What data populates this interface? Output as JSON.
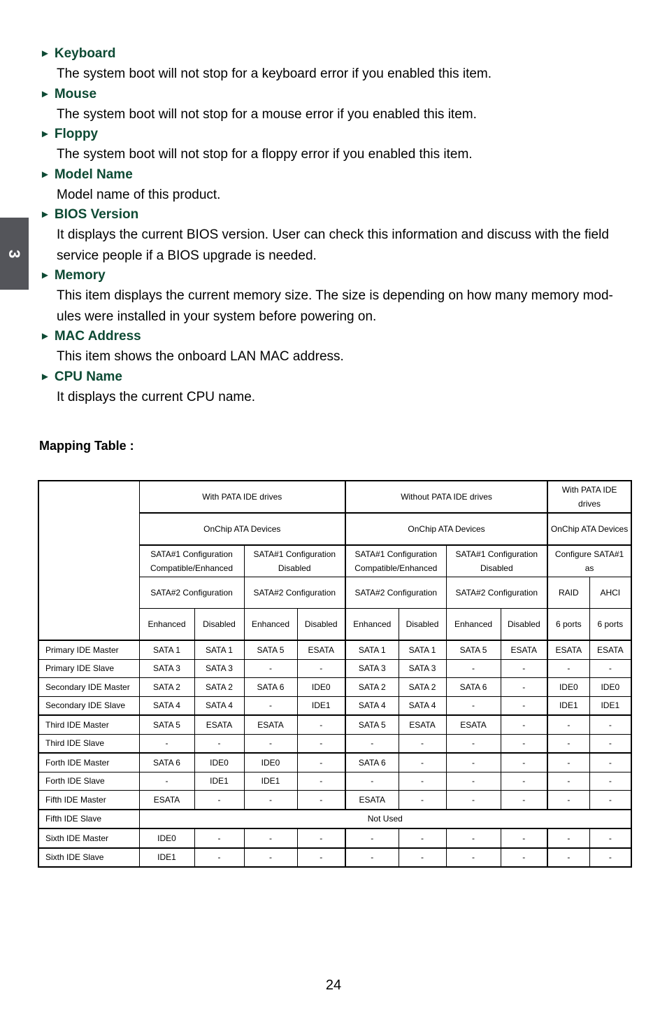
{
  "chapter_tab": "3",
  "items": [
    {
      "title": "Keyboard",
      "desc": [
        "The system boot will not stop for a keyboard error if you enabled this item."
      ]
    },
    {
      "title": "Mouse",
      "desc": [
        "The system boot will not stop for a mouse error if you enabled this item."
      ]
    },
    {
      "title": "Floppy",
      "desc": [
        "The system boot will not stop for a floppy error if you enabled this item."
      ]
    },
    {
      "title": "Model Name",
      "desc": [
        "Model name of this product."
      ]
    },
    {
      "title": "BIOS Version",
      "desc": [
        "It displays the current BIOS version. User can check this information and discuss with the field",
        "service people if a BIOS upgrade is needed."
      ]
    },
    {
      "title": "Memory",
      "desc": [
        "This item displays the current memory size. The size is depending on how many memory mod-",
        "ules were installed in your system before powering on."
      ]
    },
    {
      "title": "MAC Address",
      "desc": [
        "This item shows the onboard LAN MAC address."
      ]
    },
    {
      "title": "CPU Name",
      "desc": [
        "It displays the current CPU name."
      ]
    }
  ],
  "arrow_glyph": "►",
  "mapping_title": "Mapping Table :",
  "table": {
    "header": {
      "group1": "With PATA IDE drives",
      "group2": "Without PATA IDE drives",
      "group3": "With PATA IDE drives",
      "onchip1": "OnChip ATA Devices",
      "onchip2": "OnChip ATA Devices",
      "onchip3": "OnChip ATA Devices",
      "sata1_a": "SATA#1 Configuration Compatible/Enhanced",
      "sata1_b": "SATA#1 Configuration Disabled",
      "sata1_c": "SATA#1 Configuration Compatible/Enhanced",
      "sata1_d": "SATA#1 Configuration Disabled",
      "sata1_e": "Configure SATA#1 as",
      "sata2_a": "SATA#2 Configuration",
      "sata2_b": "SATA#2 Configuration",
      "sata2_c": "SATA#2 Configuration",
      "sata2_d": "SATA#2 Configuration",
      "raid": "RAID",
      "ahci": "AHCI",
      "leaf": [
        "Enhanced",
        "Disabled",
        "Enhanced",
        "Disabled",
        "Enhanced",
        "Disabled",
        "Enhanced",
        "Disabled",
        "6 ports",
        "6 ports"
      ]
    },
    "rows": [
      {
        "label": "Primary IDE Master",
        "cells": [
          "SATA 1",
          "SATA 1",
          "SATA 5",
          "ESATA",
          "SATA 1",
          "SATA 1",
          "SATA 5",
          "ESATA",
          "ESATA",
          "ESATA"
        ]
      },
      {
        "label": "Primary IDE Slave",
        "cells": [
          "SATA 3",
          "SATA 3",
          "-",
          "-",
          "SATA 3",
          "SATA 3",
          "-",
          "-",
          "-",
          "-"
        ]
      },
      {
        "label": "Secondary IDE Master",
        "cells": [
          "SATA 2",
          "SATA 2",
          "SATA 6",
          "IDE0",
          "SATA 2",
          "SATA 2",
          "SATA 6",
          "-",
          "IDE0",
          "IDE0"
        ]
      },
      {
        "label": "Secondary IDE Slave",
        "cells": [
          "SATA 4",
          "SATA 4",
          "-",
          "IDE1",
          "SATA 4",
          "SATA 4",
          "-",
          "-",
          "IDE1",
          "IDE1"
        ]
      },
      {
        "label": "Third IDE Master",
        "cells": [
          "SATA 5",
          "ESATA",
          "ESATA",
          "-",
          "SATA 5",
          "ESATA",
          "ESATA",
          "-",
          "-",
          "-"
        ]
      },
      {
        "label": "Third IDE Slave",
        "cells": [
          "-",
          "-",
          "-",
          "-",
          "-",
          "-",
          "-",
          "-",
          "-",
          "-"
        ]
      },
      {
        "label": "Forth IDE Master",
        "cells": [
          "SATA 6",
          "IDE0",
          "IDE0",
          "-",
          "SATA 6",
          "-",
          "-",
          "-",
          "-",
          "-"
        ]
      },
      {
        "label": "Forth IDE Slave",
        "cells": [
          "-",
          "IDE1",
          "IDE1",
          "-",
          "-",
          "-",
          "-",
          "-",
          "-",
          "-"
        ]
      },
      {
        "label": "Fifth IDE Master",
        "cells": [
          "ESATA",
          "-",
          "-",
          "-",
          "ESATA",
          "-",
          "-",
          "-",
          "-",
          "-"
        ]
      },
      {
        "label": "Fifth IDE Slave",
        "merged": "Not  Used"
      },
      {
        "label": "Sixth IDE Master",
        "cells": [
          "IDE0",
          "-",
          "-",
          "-",
          "-",
          "-",
          "-",
          "-",
          "-",
          "-"
        ]
      },
      {
        "label": "Sixth IDE Slave",
        "cells": [
          "IDE1",
          "-",
          "-",
          "-",
          "-",
          "-",
          "-",
          "-",
          "-",
          "-"
        ]
      }
    ]
  },
  "page_number": "24"
}
